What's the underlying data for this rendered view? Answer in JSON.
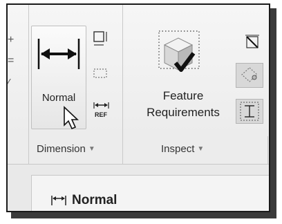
{
  "ribbon": {
    "normal_button": {
      "label": "Normal",
      "icon": "dimension-normal-icon"
    },
    "feature_requirements": {
      "label_line1": "Feature",
      "label_line2": "Requirements",
      "icon": "feature-requirements-icon"
    },
    "groups": [
      {
        "label": "Dimension"
      },
      {
        "label": "Inspect"
      }
    ],
    "dropdown_glyph": "▼"
  },
  "panel": {
    "title": "Normal",
    "icon": "dimension-normal-small-icon"
  }
}
